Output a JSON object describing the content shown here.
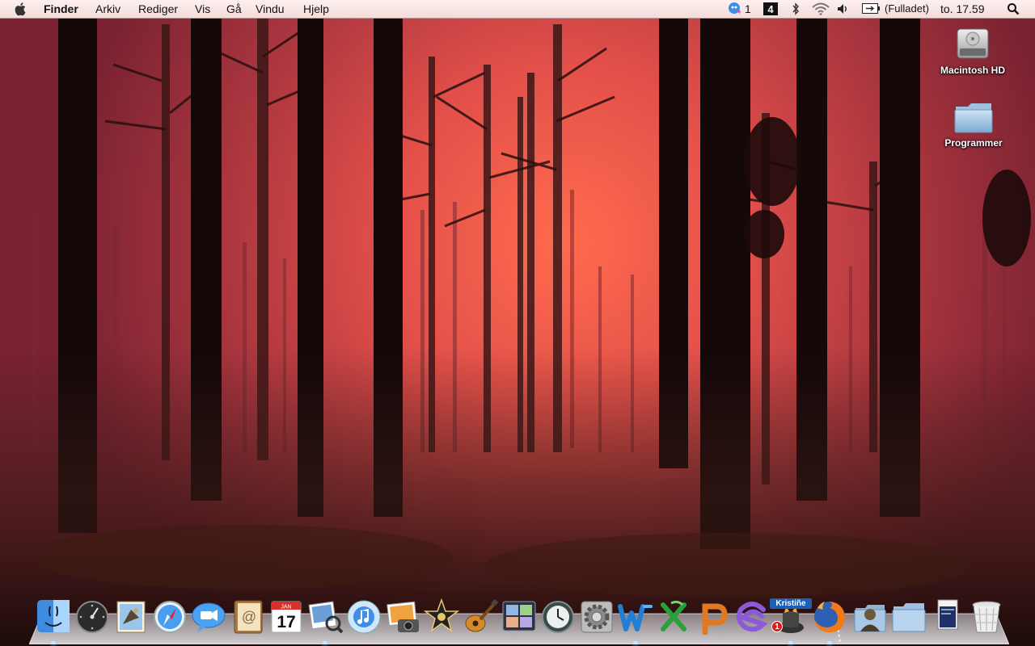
{
  "menubar": {
    "app_name": "Finder",
    "menus": [
      "Arkiv",
      "Rediger",
      "Vis",
      "Gå",
      "Vindu",
      "Hjelp"
    ],
    "status": {
      "messenger_count": "1",
      "battery_text": "(Fulladet)",
      "clock": "to. 17.59"
    },
    "icons": [
      "apple-icon",
      "messenger-icon",
      "app-4-icon",
      "bluetooth-icon",
      "wifi-icon",
      "volume-icon",
      "battery-icon",
      "spotlight-icon"
    ]
  },
  "desktop": {
    "icons": [
      {
        "label": "Macintosh HD",
        "icon": "hard-drive-icon"
      },
      {
        "label": "Programmer",
        "icon": "folder-icon"
      }
    ]
  },
  "dock": {
    "items": [
      {
        "name": "finder",
        "icon": "finder-icon",
        "running": true
      },
      {
        "name": "dashboard",
        "icon": "dashboard-icon",
        "running": false
      },
      {
        "name": "mail",
        "icon": "mail-icon",
        "running": false
      },
      {
        "name": "safari",
        "icon": "safari-icon",
        "running": false
      },
      {
        "name": "ichat",
        "icon": "ichat-icon",
        "running": false
      },
      {
        "name": "address-book",
        "icon": "address-book-icon",
        "running": false
      },
      {
        "name": "ical",
        "icon": "calendar-icon",
        "running": false,
        "calendar_month": "JAN",
        "calendar_day": "17"
      },
      {
        "name": "preview",
        "icon": "preview-icon",
        "running": true
      },
      {
        "name": "itunes",
        "icon": "itunes-icon",
        "running": false
      },
      {
        "name": "iphoto",
        "icon": "iphoto-icon",
        "running": false
      },
      {
        "name": "imovie",
        "icon": "imovie-icon",
        "running": false
      },
      {
        "name": "garageband",
        "icon": "garageband-icon",
        "running": false
      },
      {
        "name": "spaces",
        "icon": "spaces-icon",
        "running": false
      },
      {
        "name": "time-machine",
        "icon": "time-machine-icon",
        "running": false
      },
      {
        "name": "system-preferences",
        "icon": "system-preferences-icon",
        "running": false
      },
      {
        "name": "word",
        "icon": "word-icon",
        "running": true
      },
      {
        "name": "excel",
        "icon": "excel-icon",
        "running": false
      },
      {
        "name": "powerpoint",
        "icon": "powerpoint-icon",
        "running": false
      },
      {
        "name": "entourage",
        "icon": "entourage-icon",
        "running": false
      },
      {
        "name": "adium",
        "icon": "adium-icon",
        "running": true,
        "tag": "Kristiñe",
        "badge": "1"
      },
      {
        "name": "firefox",
        "icon": "firefox-icon",
        "running": true
      },
      {
        "name": "user-folder",
        "icon": "user-folder-icon",
        "running": false
      },
      {
        "name": "documents-folder",
        "icon": "folder-icon",
        "running": false
      },
      {
        "name": "documents-stack",
        "icon": "document-stack-icon",
        "running": false
      },
      {
        "name": "trash",
        "icon": "trash-icon",
        "running": false
      }
    ]
  },
  "colors": {
    "menubar": "#f6e2e0",
    "sky_glow": "#ff6a4a",
    "sky_top": "#8c2a35",
    "ground": "#2a1410"
  }
}
